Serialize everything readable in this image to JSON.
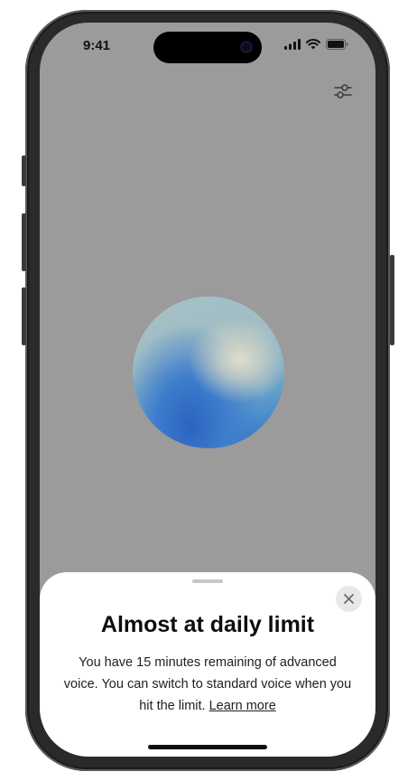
{
  "status_bar": {
    "time": "9:41"
  },
  "icons": {
    "signal": "cellular-signal-icon",
    "wifi": "wifi-icon",
    "battery": "battery-icon",
    "settings": "settings-sliders-icon",
    "close": "close-icon"
  },
  "sheet": {
    "title": "Almost at daily limit",
    "message": "You have 15 minutes remaining of advanced voice. You can switch to standard voice when you hit the limit.",
    "learn_more": "Learn more"
  },
  "colors": {
    "backdrop": "#9b9b9b",
    "sheet_bg": "#ffffff",
    "orb_blue": "#2d64c0"
  }
}
